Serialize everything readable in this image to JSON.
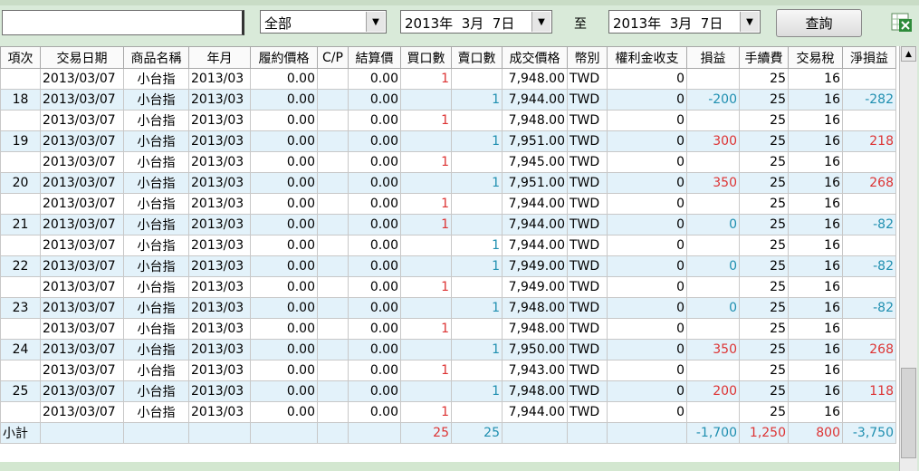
{
  "filters": {
    "product_combo": "全部",
    "date_from": "2013年  3月  7日",
    "to_label": "至",
    "date_to": "2013年  3月  7日",
    "query_button": "查詢",
    "excel_icon": "excel-export-icon"
  },
  "table": {
    "headers": [
      "項次",
      "交易日期",
      "商品名稱",
      "年月",
      "履約價格",
      "C/P",
      "結算價",
      "買口數",
      "賣口數",
      "成交價格",
      "幣別",
      "權利金收支",
      "損益",
      "手續費",
      "交易稅",
      "淨損益"
    ],
    "rows": [
      {
        "no": "",
        "date": "2013/03/07",
        "product": "小台指",
        "ym": "2013/03",
        "strike": "0.00",
        "cp": "",
        "settle": "0.00",
        "buy": "1",
        "sell": "",
        "price": "7,948.00",
        "cur": "TWD",
        "premium": "0",
        "pl": "",
        "fee": "25",
        "tax": "16",
        "net": ""
      },
      {
        "no": "18",
        "date": "2013/03/07",
        "product": "小台指",
        "ym": "2013/03",
        "strike": "0.00",
        "cp": "",
        "settle": "0.00",
        "buy": "",
        "sell": "1",
        "price": "7,944.00",
        "cur": "TWD",
        "premium": "0",
        "pl": "-200",
        "fee": "25",
        "tax": "16",
        "net": "-282"
      },
      {
        "no": "",
        "date": "2013/03/07",
        "product": "小台指",
        "ym": "2013/03",
        "strike": "0.00",
        "cp": "",
        "settle": "0.00",
        "buy": "1",
        "sell": "",
        "price": "7,948.00",
        "cur": "TWD",
        "premium": "0",
        "pl": "",
        "fee": "25",
        "tax": "16",
        "net": ""
      },
      {
        "no": "19",
        "date": "2013/03/07",
        "product": "小台指",
        "ym": "2013/03",
        "strike": "0.00",
        "cp": "",
        "settle": "0.00",
        "buy": "",
        "sell": "1",
        "price": "7,951.00",
        "cur": "TWD",
        "premium": "0",
        "pl": "300",
        "fee": "25",
        "tax": "16",
        "net": "218"
      },
      {
        "no": "",
        "date": "2013/03/07",
        "product": "小台指",
        "ym": "2013/03",
        "strike": "0.00",
        "cp": "",
        "settle": "0.00",
        "buy": "1",
        "sell": "",
        "price": "7,945.00",
        "cur": "TWD",
        "premium": "0",
        "pl": "",
        "fee": "25",
        "tax": "16",
        "net": ""
      },
      {
        "no": "20",
        "date": "2013/03/07",
        "product": "小台指",
        "ym": "2013/03",
        "strike": "0.00",
        "cp": "",
        "settle": "0.00",
        "buy": "",
        "sell": "1",
        "price": "7,951.00",
        "cur": "TWD",
        "premium": "0",
        "pl": "350",
        "fee": "25",
        "tax": "16",
        "net": "268"
      },
      {
        "no": "",
        "date": "2013/03/07",
        "product": "小台指",
        "ym": "2013/03",
        "strike": "0.00",
        "cp": "",
        "settle": "0.00",
        "buy": "1",
        "sell": "",
        "price": "7,944.00",
        "cur": "TWD",
        "premium": "0",
        "pl": "",
        "fee": "25",
        "tax": "16",
        "net": ""
      },
      {
        "no": "21",
        "date": "2013/03/07",
        "product": "小台指",
        "ym": "2013/03",
        "strike": "0.00",
        "cp": "",
        "settle": "0.00",
        "buy": "1",
        "sell": "",
        "price": "7,944.00",
        "cur": "TWD",
        "premium": "0",
        "pl": "0",
        "fee": "25",
        "tax": "16",
        "net": "-82"
      },
      {
        "no": "",
        "date": "2013/03/07",
        "product": "小台指",
        "ym": "2013/03",
        "strike": "0.00",
        "cp": "",
        "settle": "0.00",
        "buy": "",
        "sell": "1",
        "price": "7,944.00",
        "cur": "TWD",
        "premium": "0",
        "pl": "",
        "fee": "25",
        "tax": "16",
        "net": ""
      },
      {
        "no": "22",
        "date": "2013/03/07",
        "product": "小台指",
        "ym": "2013/03",
        "strike": "0.00",
        "cp": "",
        "settle": "0.00",
        "buy": "",
        "sell": "1",
        "price": "7,949.00",
        "cur": "TWD",
        "premium": "0",
        "pl": "0",
        "fee": "25",
        "tax": "16",
        "net": "-82"
      },
      {
        "no": "",
        "date": "2013/03/07",
        "product": "小台指",
        "ym": "2013/03",
        "strike": "0.00",
        "cp": "",
        "settle": "0.00",
        "buy": "1",
        "sell": "",
        "price": "7,949.00",
        "cur": "TWD",
        "premium": "0",
        "pl": "",
        "fee": "25",
        "tax": "16",
        "net": ""
      },
      {
        "no": "23",
        "date": "2013/03/07",
        "product": "小台指",
        "ym": "2013/03",
        "strike": "0.00",
        "cp": "",
        "settle": "0.00",
        "buy": "",
        "sell": "1",
        "price": "7,948.00",
        "cur": "TWD",
        "premium": "0",
        "pl": "0",
        "fee": "25",
        "tax": "16",
        "net": "-82"
      },
      {
        "no": "",
        "date": "2013/03/07",
        "product": "小台指",
        "ym": "2013/03",
        "strike": "0.00",
        "cp": "",
        "settle": "0.00",
        "buy": "1",
        "sell": "",
        "price": "7,948.00",
        "cur": "TWD",
        "premium": "0",
        "pl": "",
        "fee": "25",
        "tax": "16",
        "net": ""
      },
      {
        "no": "24",
        "date": "2013/03/07",
        "product": "小台指",
        "ym": "2013/03",
        "strike": "0.00",
        "cp": "",
        "settle": "0.00",
        "buy": "",
        "sell": "1",
        "price": "7,950.00",
        "cur": "TWD",
        "premium": "0",
        "pl": "350",
        "fee": "25",
        "tax": "16",
        "net": "268"
      },
      {
        "no": "",
        "date": "2013/03/07",
        "product": "小台指",
        "ym": "2013/03",
        "strike": "0.00",
        "cp": "",
        "settle": "0.00",
        "buy": "1",
        "sell": "",
        "price": "7,943.00",
        "cur": "TWD",
        "premium": "0",
        "pl": "",
        "fee": "25",
        "tax": "16",
        "net": ""
      },
      {
        "no": "25",
        "date": "2013/03/07",
        "product": "小台指",
        "ym": "2013/03",
        "strike": "0.00",
        "cp": "",
        "settle": "0.00",
        "buy": "",
        "sell": "1",
        "price": "7,948.00",
        "cur": "TWD",
        "premium": "0",
        "pl": "200",
        "fee": "25",
        "tax": "16",
        "net": "118"
      },
      {
        "no": "",
        "date": "2013/03/07",
        "product": "小台指",
        "ym": "2013/03",
        "strike": "0.00",
        "cp": "",
        "settle": "0.00",
        "buy": "1",
        "sell": "",
        "price": "7,944.00",
        "cur": "TWD",
        "premium": "0",
        "pl": "",
        "fee": "25",
        "tax": "16",
        "net": ""
      }
    ],
    "subtotal": {
      "label": "小計",
      "buy": "25",
      "sell": "25",
      "pl": "-1,700",
      "fee": "1,250",
      "tax": "800",
      "net": "-3,750"
    }
  },
  "colors": {
    "positive": "#d33",
    "nonpositive": "#1f8fb0",
    "alt_row": "#e3f2fa",
    "panel": "#d9ead9"
  }
}
